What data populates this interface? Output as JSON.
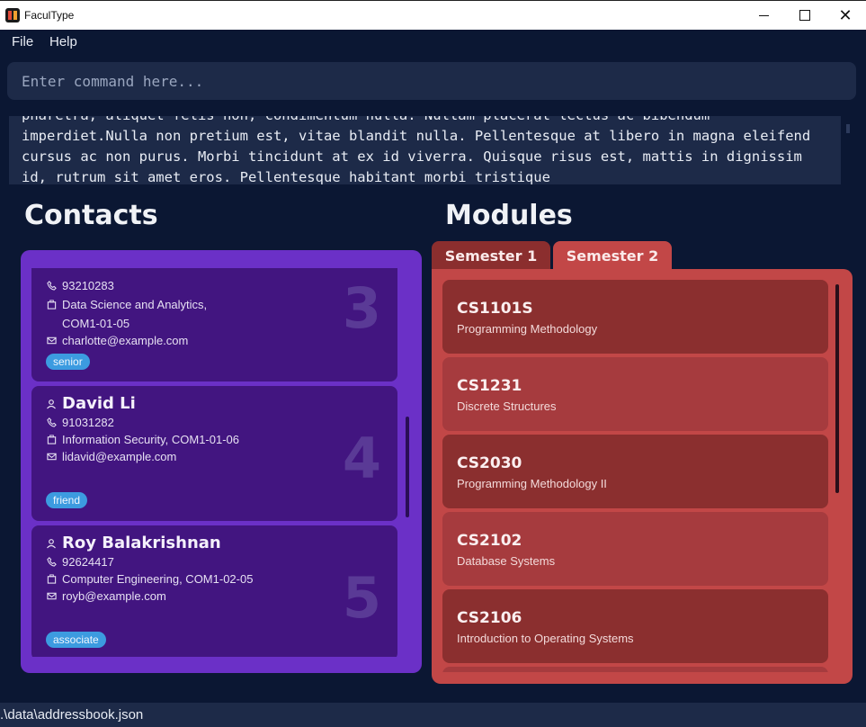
{
  "window": {
    "title": "FaculType",
    "close_glyph": "✕"
  },
  "menu": {
    "file": "File",
    "help": "Help"
  },
  "command": {
    "placeholder": "Enter command here..."
  },
  "result": {
    "text": "pharetra, aliquet felis non, condimentum nulla. Nullam placerat lectus ac bibendum imperdiet.Nulla non pretium est, vitae blandit nulla. Pellentesque at libero in magna eleifend cursus ac non purus. Morbi tincidunt at ex id viverra. Quisque risus est, mattis in dignissim id, rutrum sit amet eros. Pellentesque habitant morbi tristique"
  },
  "contacts": {
    "title": "Contacts",
    "items": [
      {
        "index": "3",
        "phone": "93210283",
        "office_line1": "Data Science and Analytics,",
        "office_line2": "COM1-01-05",
        "email": "charlotte@example.com",
        "tag": "senior"
      },
      {
        "index": "4",
        "name": "David Li",
        "phone": "91031282",
        "office": "Information Security, COM1-01-06",
        "email": "lidavid@example.com",
        "tag": "friend"
      },
      {
        "index": "5",
        "name": "Roy Balakrishnan",
        "phone": "92624417",
        "office": "Computer Engineering, COM1-02-05",
        "email": "royb@example.com",
        "tag": "associate"
      }
    ]
  },
  "modules": {
    "title": "Modules",
    "tabs": [
      "Semester 1",
      "Semester 2"
    ],
    "selected_tab": "Semester 2",
    "items": [
      {
        "code": "CS1101S",
        "name": "Programming Methodology"
      },
      {
        "code": "CS1231",
        "name": "Discrete Structures"
      },
      {
        "code": "CS2030",
        "name": "Programming Methodology II"
      },
      {
        "code": "CS2102",
        "name": "Database Systems"
      },
      {
        "code": "CS2106",
        "name": "Introduction to Operating Systems"
      }
    ]
  },
  "status": {
    "path": ".\\data\\addressbook.json"
  },
  "colors": {
    "background": "#0b1733",
    "contacts_panel": "#6b30c7",
    "contact_card": "#421580",
    "modules_panel": "#c24747",
    "module_card_dark": "#8b2f2f",
    "module_card_light": "#a63b3e",
    "tag": "#3c9be0"
  }
}
